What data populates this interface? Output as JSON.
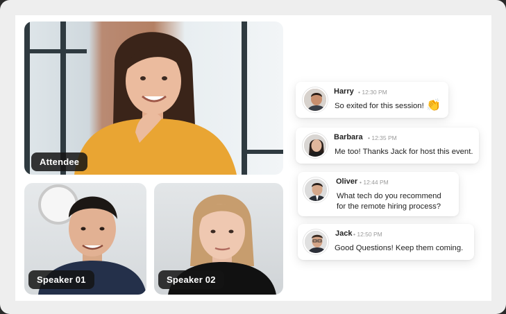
{
  "tiles": {
    "attendee_label": "Attendee",
    "speaker1_label": "Speaker 01",
    "speaker2_label": "Speaker 02"
  },
  "chat": {
    "messages": [
      {
        "name": "Harry",
        "time": "12:30 PM",
        "text": "So exited for this session!",
        "emoji": "👏"
      },
      {
        "name": "Barbara",
        "time": "12:35 PM",
        "text": "Me too! Thanks Jack for host this event."
      },
      {
        "name": "Oliver",
        "time": "12:44 PM",
        "text_line1": "What tech do you recommend",
        "text_line2": "for the remote hiring process?"
      },
      {
        "name": "Jack",
        "time": "12:50 PM",
        "text": "Good Questions! Keep them coming."
      }
    ]
  },
  "colors": {
    "frame": "#eeeeee",
    "canvas": "#ffffff",
    "label_bg": "#141414",
    "accent_sweater": "#e9a533"
  },
  "icons": [
    "clap-emoji-icon",
    "avatar-harry",
    "avatar-barbara",
    "avatar-oliver",
    "avatar-jack"
  ]
}
